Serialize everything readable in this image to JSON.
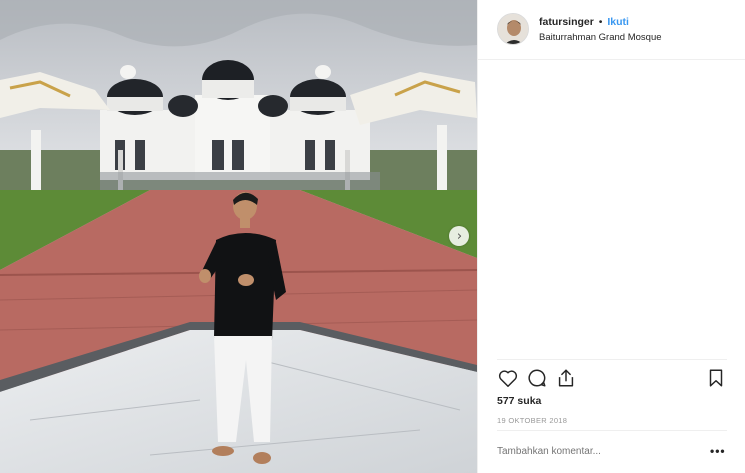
{
  "post": {
    "username": "fatursinger",
    "separator": "•",
    "follow_label": "Ikuti",
    "location": "Baiturrahman Grand Mosque",
    "likes": "577 suka",
    "date": "19 OKTOBER 2018",
    "comment_placeholder": "Tambahkan komentar...",
    "more_label": "•••"
  },
  "icons": {
    "next": "chevron-right-icon",
    "like": "heart-icon",
    "comment": "comment-bubble-icon",
    "share": "share-icon",
    "save": "bookmark-icon"
  },
  "colors": {
    "accent": "#3897f0",
    "text": "#262626",
    "muted": "#999999",
    "border": "#efefef"
  }
}
